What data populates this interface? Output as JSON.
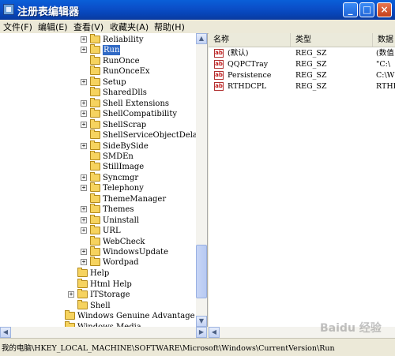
{
  "window": {
    "title": "注册表编辑器",
    "controls": {
      "minimize": "_",
      "maximize": "□",
      "close": "×"
    }
  },
  "menu": [
    "文件(F)",
    "编辑(E)",
    "查看(V)",
    "收藏夹(A)",
    "帮助(H)"
  ],
  "tree": {
    "rows": [
      {
        "label": "Reliability",
        "expander": "+"
      },
      {
        "label": "Run",
        "expander": "+",
        "selected": true
      },
      {
        "label": "RunOnce",
        "expander": ""
      },
      {
        "label": "RunOnceEx",
        "expander": ""
      },
      {
        "label": "Setup",
        "expander": "+"
      },
      {
        "label": "SharedDlls",
        "expander": ""
      },
      {
        "label": "Shell Extensions",
        "expander": "+"
      },
      {
        "label": "ShellCompatibility",
        "expander": "+"
      },
      {
        "label": "ShellScrap",
        "expander": "+"
      },
      {
        "label": "ShellServiceObjectDelay",
        "expander": ""
      },
      {
        "label": "SideBySide",
        "expander": "+"
      },
      {
        "label": "SMDEn",
        "expander": ""
      },
      {
        "label": "StillImage",
        "expander": ""
      },
      {
        "label": "Syncmgr",
        "expander": "+"
      },
      {
        "label": "Telephony",
        "expander": "+"
      },
      {
        "label": "ThemeManager",
        "expander": ""
      },
      {
        "label": "Themes",
        "expander": "+"
      },
      {
        "label": "Uninstall",
        "expander": "+"
      },
      {
        "label": "URL",
        "expander": "+"
      },
      {
        "label": "WebCheck",
        "expander": ""
      },
      {
        "label": "WindowsUpdate",
        "expander": "+"
      },
      {
        "label": "Wordpad",
        "expander": "+"
      },
      {
        "label": "Help",
        "expander": ""
      },
      {
        "label": "Html Help",
        "expander": ""
      },
      {
        "label": "ITStorage",
        "expander": "+"
      },
      {
        "label": "Shell",
        "expander": ""
      },
      {
        "label": "Windows Genuine Advantage",
        "expander": ""
      },
      {
        "label": "Windows Media",
        "expander": ""
      }
    ]
  },
  "list": {
    "columns": [
      "名称",
      "类型",
      "数据"
    ],
    "rows": [
      {
        "name": "(默认)",
        "type": "REG_SZ",
        "data": "(数值"
      },
      {
        "name": "QQPCTray",
        "type": "REG_SZ",
        "data": "\"C:\\"
      },
      {
        "name": "Persistence",
        "type": "REG_SZ",
        "data": "C:\\W"
      },
      {
        "name": "RTHDCPL",
        "type": "REG_SZ",
        "data": "RTHDC"
      }
    ],
    "icon": "reg-sz-icon"
  },
  "status": {
    "path": "我的电脑\\HKEY_LOCAL_MACHINE\\SOFTWARE\\Microsoft\\Windows\\CurrentVersion\\Run"
  },
  "watermark": "Baidu 经验",
  "colors": {
    "title_bar": "#0b4fc9",
    "selection": "#316ac5",
    "window_bg": "#ece9d8"
  }
}
